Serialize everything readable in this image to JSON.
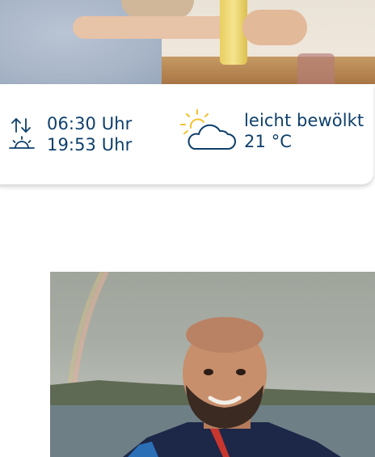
{
  "sun_times": {
    "sunrise": "06:30 Uhr",
    "sunset": "19:53 Uhr",
    "icon": "sunrise-sunset-icon"
  },
  "weather": {
    "condition": "leicht bewölkt",
    "temperature": "21 °C",
    "icon": "partly-cloudy-icon"
  },
  "colors": {
    "text": "#0d3f6b",
    "sun": "#f2c12e"
  }
}
